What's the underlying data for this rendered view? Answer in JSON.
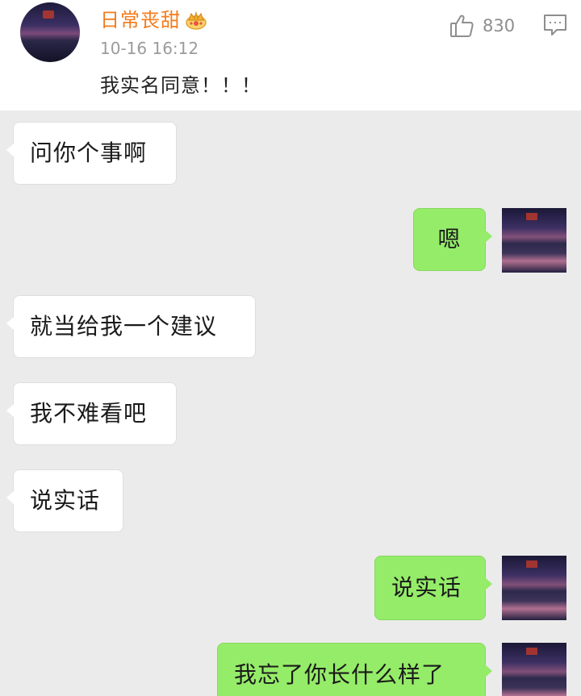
{
  "comment": {
    "author": "日常丧甜",
    "badge_icon": "crown-badge-icon",
    "time": "10-16 16:12",
    "text": "我实名同意！！！",
    "likes": "830",
    "author_color": "#f47c1c"
  },
  "chat": {
    "background": "#ebebeb",
    "incoming_color": "#ffffff",
    "outgoing_color": "#95ec69",
    "messages": [
      {
        "side": "in",
        "text": "问你个事啊"
      },
      {
        "side": "out",
        "text": "嗯"
      },
      {
        "side": "in",
        "text": "就当给我一个建议"
      },
      {
        "side": "in",
        "text": "我不难看吧"
      },
      {
        "side": "in",
        "text": "说实话"
      },
      {
        "side": "out",
        "text": "说实话"
      },
      {
        "side": "out",
        "text": "我忘了你长什么样了"
      }
    ]
  }
}
